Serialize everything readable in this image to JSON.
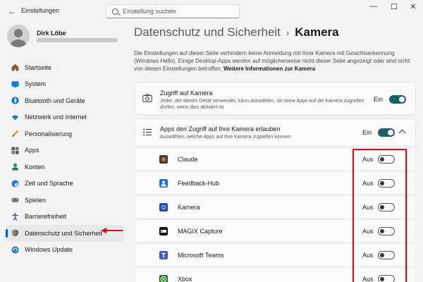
{
  "window": {
    "title": "Einstellungen",
    "back_glyph": "←",
    "minimize_glyph": "—",
    "maximize_glyph": "☐",
    "close_glyph": "✕"
  },
  "search": {
    "placeholder": "Einstellung suchen"
  },
  "user": {
    "name": "Dirk Löbe"
  },
  "sidebar": {
    "items": [
      {
        "label": "Startseite",
        "icon": "home-icon"
      },
      {
        "label": "System",
        "icon": "monitor-icon"
      },
      {
        "label": "Bluetooth und Geräte",
        "icon": "bluetooth-icon"
      },
      {
        "label": "Netzwerk und Internet",
        "icon": "wifi-icon"
      },
      {
        "label": "Personalisierung",
        "icon": "brush-icon"
      },
      {
        "label": "Apps",
        "icon": "apps-icon"
      },
      {
        "label": "Konten",
        "icon": "person-icon"
      },
      {
        "label": "Zeit und Sprache",
        "icon": "globe-clock-icon"
      },
      {
        "label": "Spielen",
        "icon": "gamepad-icon"
      },
      {
        "label": "Barrierefreiheit",
        "icon": "accessibility-icon"
      },
      {
        "label": "Datenschutz und Sicherheit",
        "icon": "shield-icon",
        "active": true
      },
      {
        "label": "Windows Update",
        "icon": "update-icon"
      }
    ]
  },
  "main": {
    "breadcrumb_parent": "Datenschutz und Sicherheit",
    "breadcrumb_sep": "›",
    "breadcrumb_current": "Kamera",
    "description": "Die Einstellungen auf dieser Seite verhindern keine Anmeldung mit Ihrer Kamera mit Gesichtserkennung (Windows Hello). Einige Desktop-Apps werden auf möglicherweise nicht dieser Seite angezeigt oder sind nicht von diesen Einstellungen betroffen.",
    "description_link": "Weitere Informationen zur Kamera",
    "camera_access": {
      "title": "Zugriff auf Kamera",
      "subtitle": "Jeder, der dieses Gerät verwendet, kann auswählen, ob seine Apps auf die Kamera zugreifen dürfen, wenn dies aktiviert ist",
      "status": "Ein",
      "on": true
    },
    "apps_access": {
      "title": "Apps den Zugriff auf Ihre Kamera erlauben",
      "subtitle": "Auswählen, welche Apps auf Ihre Kamera zugreifen können",
      "status": "Ein",
      "on": true
    },
    "apps": [
      {
        "name": "Claude",
        "status": "Aus",
        "on": false,
        "icon": "claude-icon",
        "color": "#3a3a3a"
      },
      {
        "name": "Feedback-Hub",
        "status": "Aus",
        "on": false,
        "icon": "feedback-hub-icon",
        "color": "#1e6fd9"
      },
      {
        "name": "Kamera",
        "status": "Aus",
        "on": false,
        "icon": "camera-app-icon",
        "color": "#2a4fa8"
      },
      {
        "name": "MAGIX Capture",
        "status": "Aus",
        "on": false,
        "icon": "magix-icon",
        "color": "#111111"
      },
      {
        "name": "Microsoft Teams",
        "status": "Aus",
        "on": false,
        "icon": "teams-icon",
        "color": "#4b53bc"
      },
      {
        "name": "Xbox",
        "status": "Aus",
        "on": false,
        "icon": "xbox-icon",
        "color": "#107c10"
      }
    ]
  },
  "colors": {
    "accent": "#005fb8",
    "toggle_on": "#1f5f68",
    "annotation_red": "#e3001b"
  }
}
